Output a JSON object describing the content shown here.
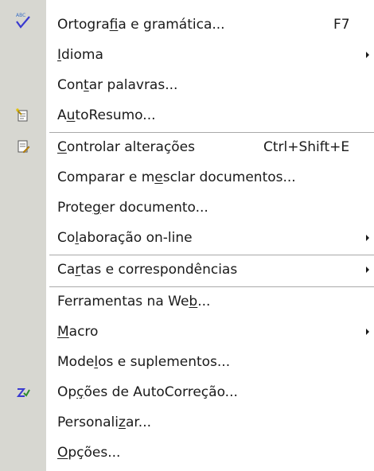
{
  "menu": {
    "items": [
      {
        "pre": "Ortogra",
        "ul": "f",
        "post": "ia e gramática...",
        "shortcut": "F7",
        "icon": "spelling-check-icon"
      },
      {
        "pre": "",
        "ul": "I",
        "post": "dioma",
        "submenu": true
      },
      {
        "pre": "Con",
        "ul": "t",
        "post": "ar palavras..."
      },
      {
        "pre": "A",
        "ul": "u",
        "post": "toResumo...",
        "icon": "autosummarize-icon"
      },
      {
        "pre": "",
        "ul": "C",
        "post": "ontrolar alterações",
        "shortcut": "Ctrl+Shift+E",
        "icon": "track-changes-icon"
      },
      {
        "pre": "Comparar e m",
        "ul": "e",
        "post": "sclar documentos..."
      },
      {
        "pre": "Prote",
        "ul": "g",
        "post": "er documento..."
      },
      {
        "pre": "Co",
        "ul": "l",
        "post": "aboração on-line",
        "submenu": true
      },
      {
        "pre": "Ca",
        "ul": "r",
        "post": "tas e correspondências",
        "submenu": true
      },
      {
        "pre": "Ferramentas na We",
        "ul": "b",
        "post": "..."
      },
      {
        "pre": "",
        "ul": "M",
        "post": "acro",
        "submenu": true
      },
      {
        "pre": "Mode",
        "ul": "l",
        "post": "os e suplementos..."
      },
      {
        "pre": "Op",
        "ul": "ç",
        "post": "ões de AutoCorreção...",
        "icon": "autocorrect-icon"
      },
      {
        "pre": "Personali",
        "ul": "z",
        "post": "ar..."
      },
      {
        "pre": "",
        "ul": "O",
        "post": "pções..."
      }
    ]
  }
}
